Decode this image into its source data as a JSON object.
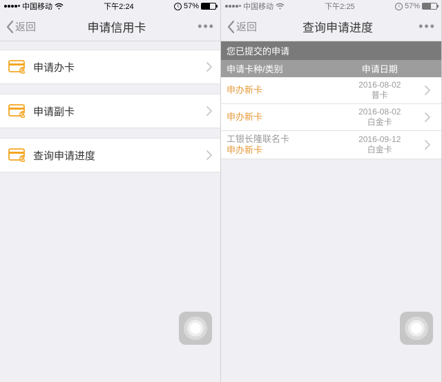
{
  "left": {
    "status": {
      "carrier": "中国移动",
      "time": "下午2:24",
      "battery": "57%"
    },
    "nav": {
      "back": "返回",
      "title": "申请信用卡",
      "more": "•••"
    },
    "rows": [
      {
        "label": "申请办卡"
      },
      {
        "label": "申请副卡"
      },
      {
        "label": "查询申请进度"
      }
    ]
  },
  "right": {
    "status": {
      "carrier": "中国移动",
      "time": "下午2:25",
      "battery": "57%"
    },
    "nav": {
      "back": "返回",
      "title": "查询申请进度",
      "more": "•••"
    },
    "section": "您已提交的申请",
    "headers": {
      "col1": "申请卡种/类别",
      "col2": "申请日期"
    },
    "apps": [
      {
        "line1": "申办新卡",
        "date": "2016-08-02",
        "cardclass": "普卡"
      },
      {
        "line1": "申办新卡",
        "date": "2016-08-02",
        "cardclass": "白金卡"
      },
      {
        "line0": "工银长隆联名卡",
        "line1": "申办新卡",
        "date": "2016-09-12",
        "cardclass": "白金卡"
      }
    ]
  }
}
